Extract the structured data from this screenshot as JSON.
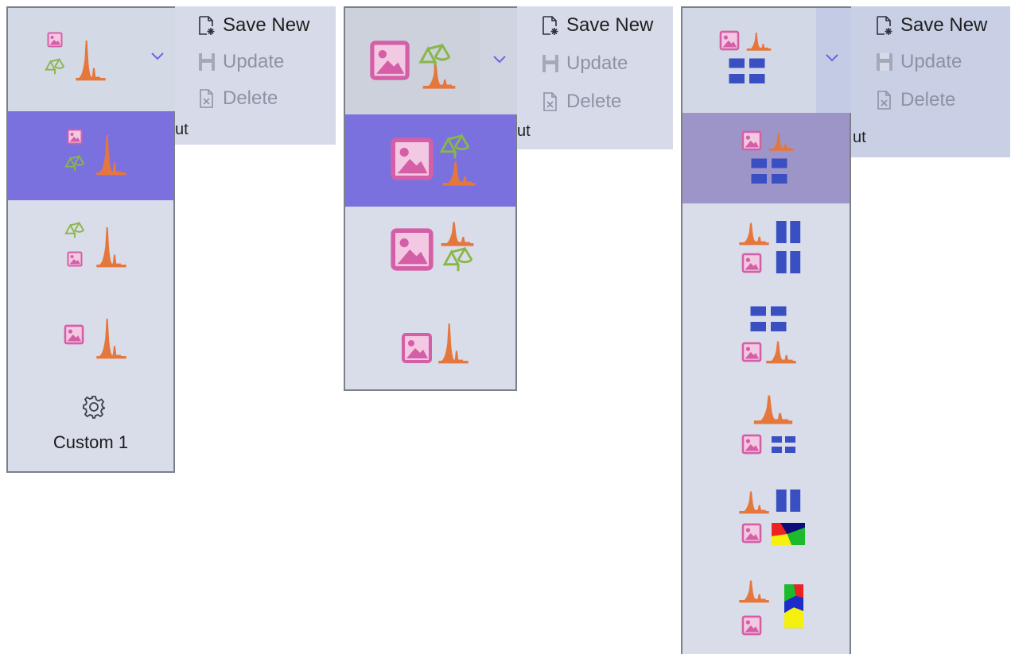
{
  "actions": {
    "save_new": "Save New",
    "update": "Update",
    "delete": "Delete",
    "group_label_fragment": "ut"
  },
  "panels": [
    {
      "variant": "single-image-with-gating",
      "selected_index": 0,
      "items": [
        {
          "icon": "image-gating-spectrum-layout-icon"
        },
        {
          "icon": "gating-image-spectrum-layout-icon"
        },
        {
          "icon": "image-spectrum-layout-icon"
        },
        {
          "icon": "gear-icon",
          "label": "Custom 1"
        }
      ]
    },
    {
      "variant": "large-image-with-gating",
      "selected_index": 0,
      "items": [
        {
          "icon": "large-image-gating-spectrum-layout-icon"
        },
        {
          "icon": "large-image-spectrum-gating-layout-icon"
        },
        {
          "icon": "image-spectrum-layout-icon"
        }
      ]
    },
    {
      "variant": "multi-tile-layouts",
      "selected_index": 0,
      "items": [
        {
          "icon": "image-spectrum-tiles-layout-icon"
        },
        {
          "icon": "spectrum-image-tile-columns-layout-icon"
        },
        {
          "icon": "tiles-image-spectrum-layout-icon"
        },
        {
          "icon": "spectrum-image-tiles-layout-icon"
        },
        {
          "icon": "spectrum-image-tiles-mapping-layout-icon"
        },
        {
          "icon": "spectrum-image-tall-mapping-layout-icon"
        }
      ]
    }
  ],
  "colors": {
    "selected": "#7b71de",
    "selected_muted": "#9d95c8",
    "image": "#d45fa7",
    "spectrum": "#e6773c",
    "gating": "#89b649",
    "tiles": "#3a4fc2",
    "menu_bg": "#d9dde9"
  }
}
